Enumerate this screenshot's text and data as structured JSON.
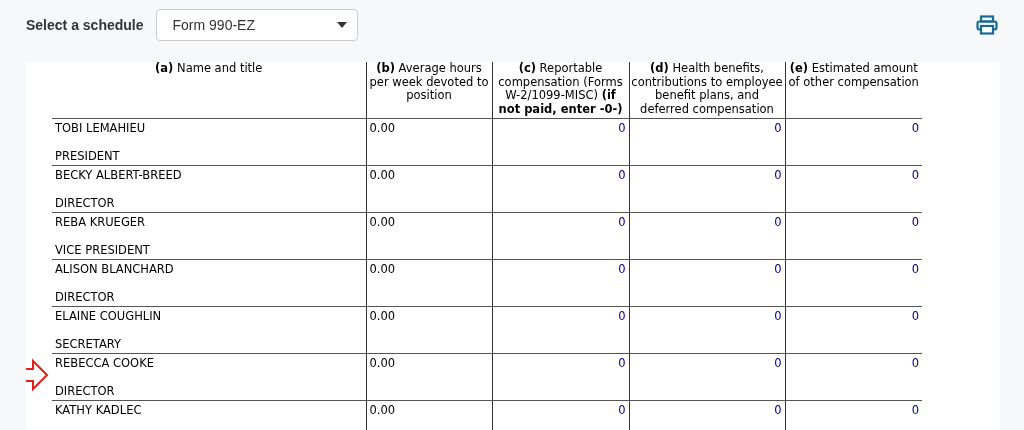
{
  "toolbar": {
    "label": "Select a schedule",
    "select_value": "Form 990-EZ"
  },
  "table": {
    "columns": [
      "**(a)** Name and title",
      "**(b)** Average hours per week devoted to position",
      "**(c)** Reportable compensation (Forms W-2/1099-MISC) **(if not paid, enter -0-)**",
      "**(d)** Health benefits, contributions to employee benefit plans, and deferred compensation",
      "**(e)** Estimated amount of other compensation"
    ],
    "rows": [
      {
        "name": "TOBI LEMAHIEU",
        "title": "PRESIDENT",
        "hours": "0.00",
        "reportable": "0",
        "benefits": "0",
        "other": "0",
        "marked": false
      },
      {
        "name": "BECKY ALBERT-BREED",
        "title": "DIRECTOR",
        "hours": "0.00",
        "reportable": "0",
        "benefits": "0",
        "other": "0",
        "marked": false
      },
      {
        "name": "REBA KRUEGER",
        "title": "VICE PRESIDENT",
        "hours": "0.00",
        "reportable": "0",
        "benefits": "0",
        "other": "0",
        "marked": false
      },
      {
        "name": "ALISON BLANCHARD",
        "title": "DIRECTOR",
        "hours": "0.00",
        "reportable": "0",
        "benefits": "0",
        "other": "0",
        "marked": false
      },
      {
        "name": "ELAINE COUGHLIN",
        "title": "SECRETARY",
        "hours": "0.00",
        "reportable": "0",
        "benefits": "0",
        "other": "0",
        "marked": false
      },
      {
        "name": "REBECCA COOKE",
        "title": "DIRECTOR",
        "hours": "0.00",
        "reportable": "0",
        "benefits": "0",
        "other": "0",
        "marked": true
      },
      {
        "name": "KATHY KADLEC",
        "hours": "0.00",
        "reportable": "0",
        "benefits": "0",
        "other": "0",
        "marked": false
      }
    ]
  }
}
